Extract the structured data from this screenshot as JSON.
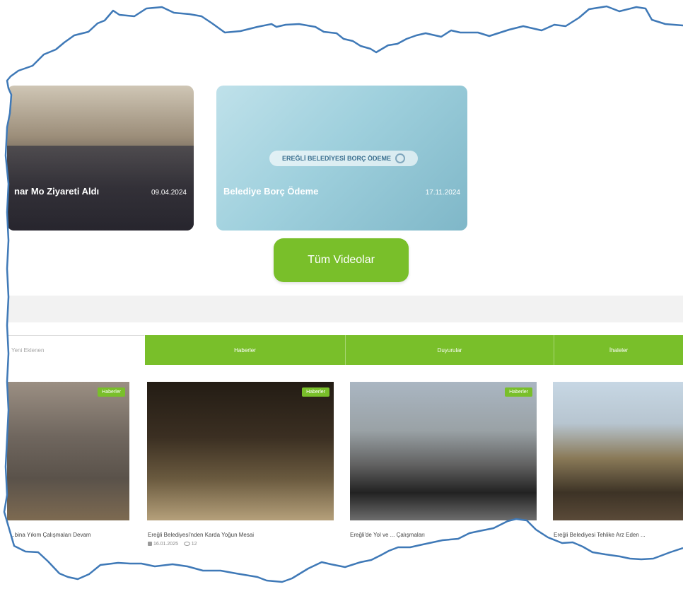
{
  "videos": {
    "cards": [
      {
        "title": "nar Mo Ziyareti Aldı",
        "date": "09.04.2024"
      },
      {
        "title": "Belediye Borç Ödeme",
        "date": "17.11.2024",
        "pill": "EREĞLİ BELEDİYESİ BORÇ ÖDEME"
      }
    ],
    "all_videos_label": "Tüm Videolar"
  },
  "tabs": [
    "Yeni Eklenen",
    "Haberler",
    "Duyurular",
    "İhaleler"
  ],
  "news": [
    {
      "caption": "...bina Yıkım Çalışmaları Devam",
      "badge": "Haberler"
    },
    {
      "caption": "Ereğli Belediyesi'nden Karda Yoğun Mesai",
      "badge": "Haberler",
      "date": "16.01.2025",
      "views": "12"
    },
    {
      "caption": "Ereğli'de Yol ve ... Çalışmaları",
      "badge": "Haberler"
    },
    {
      "caption": "Ereğli Belediyesi Tehlike Arz Eden ...",
      "badge": ""
    }
  ]
}
